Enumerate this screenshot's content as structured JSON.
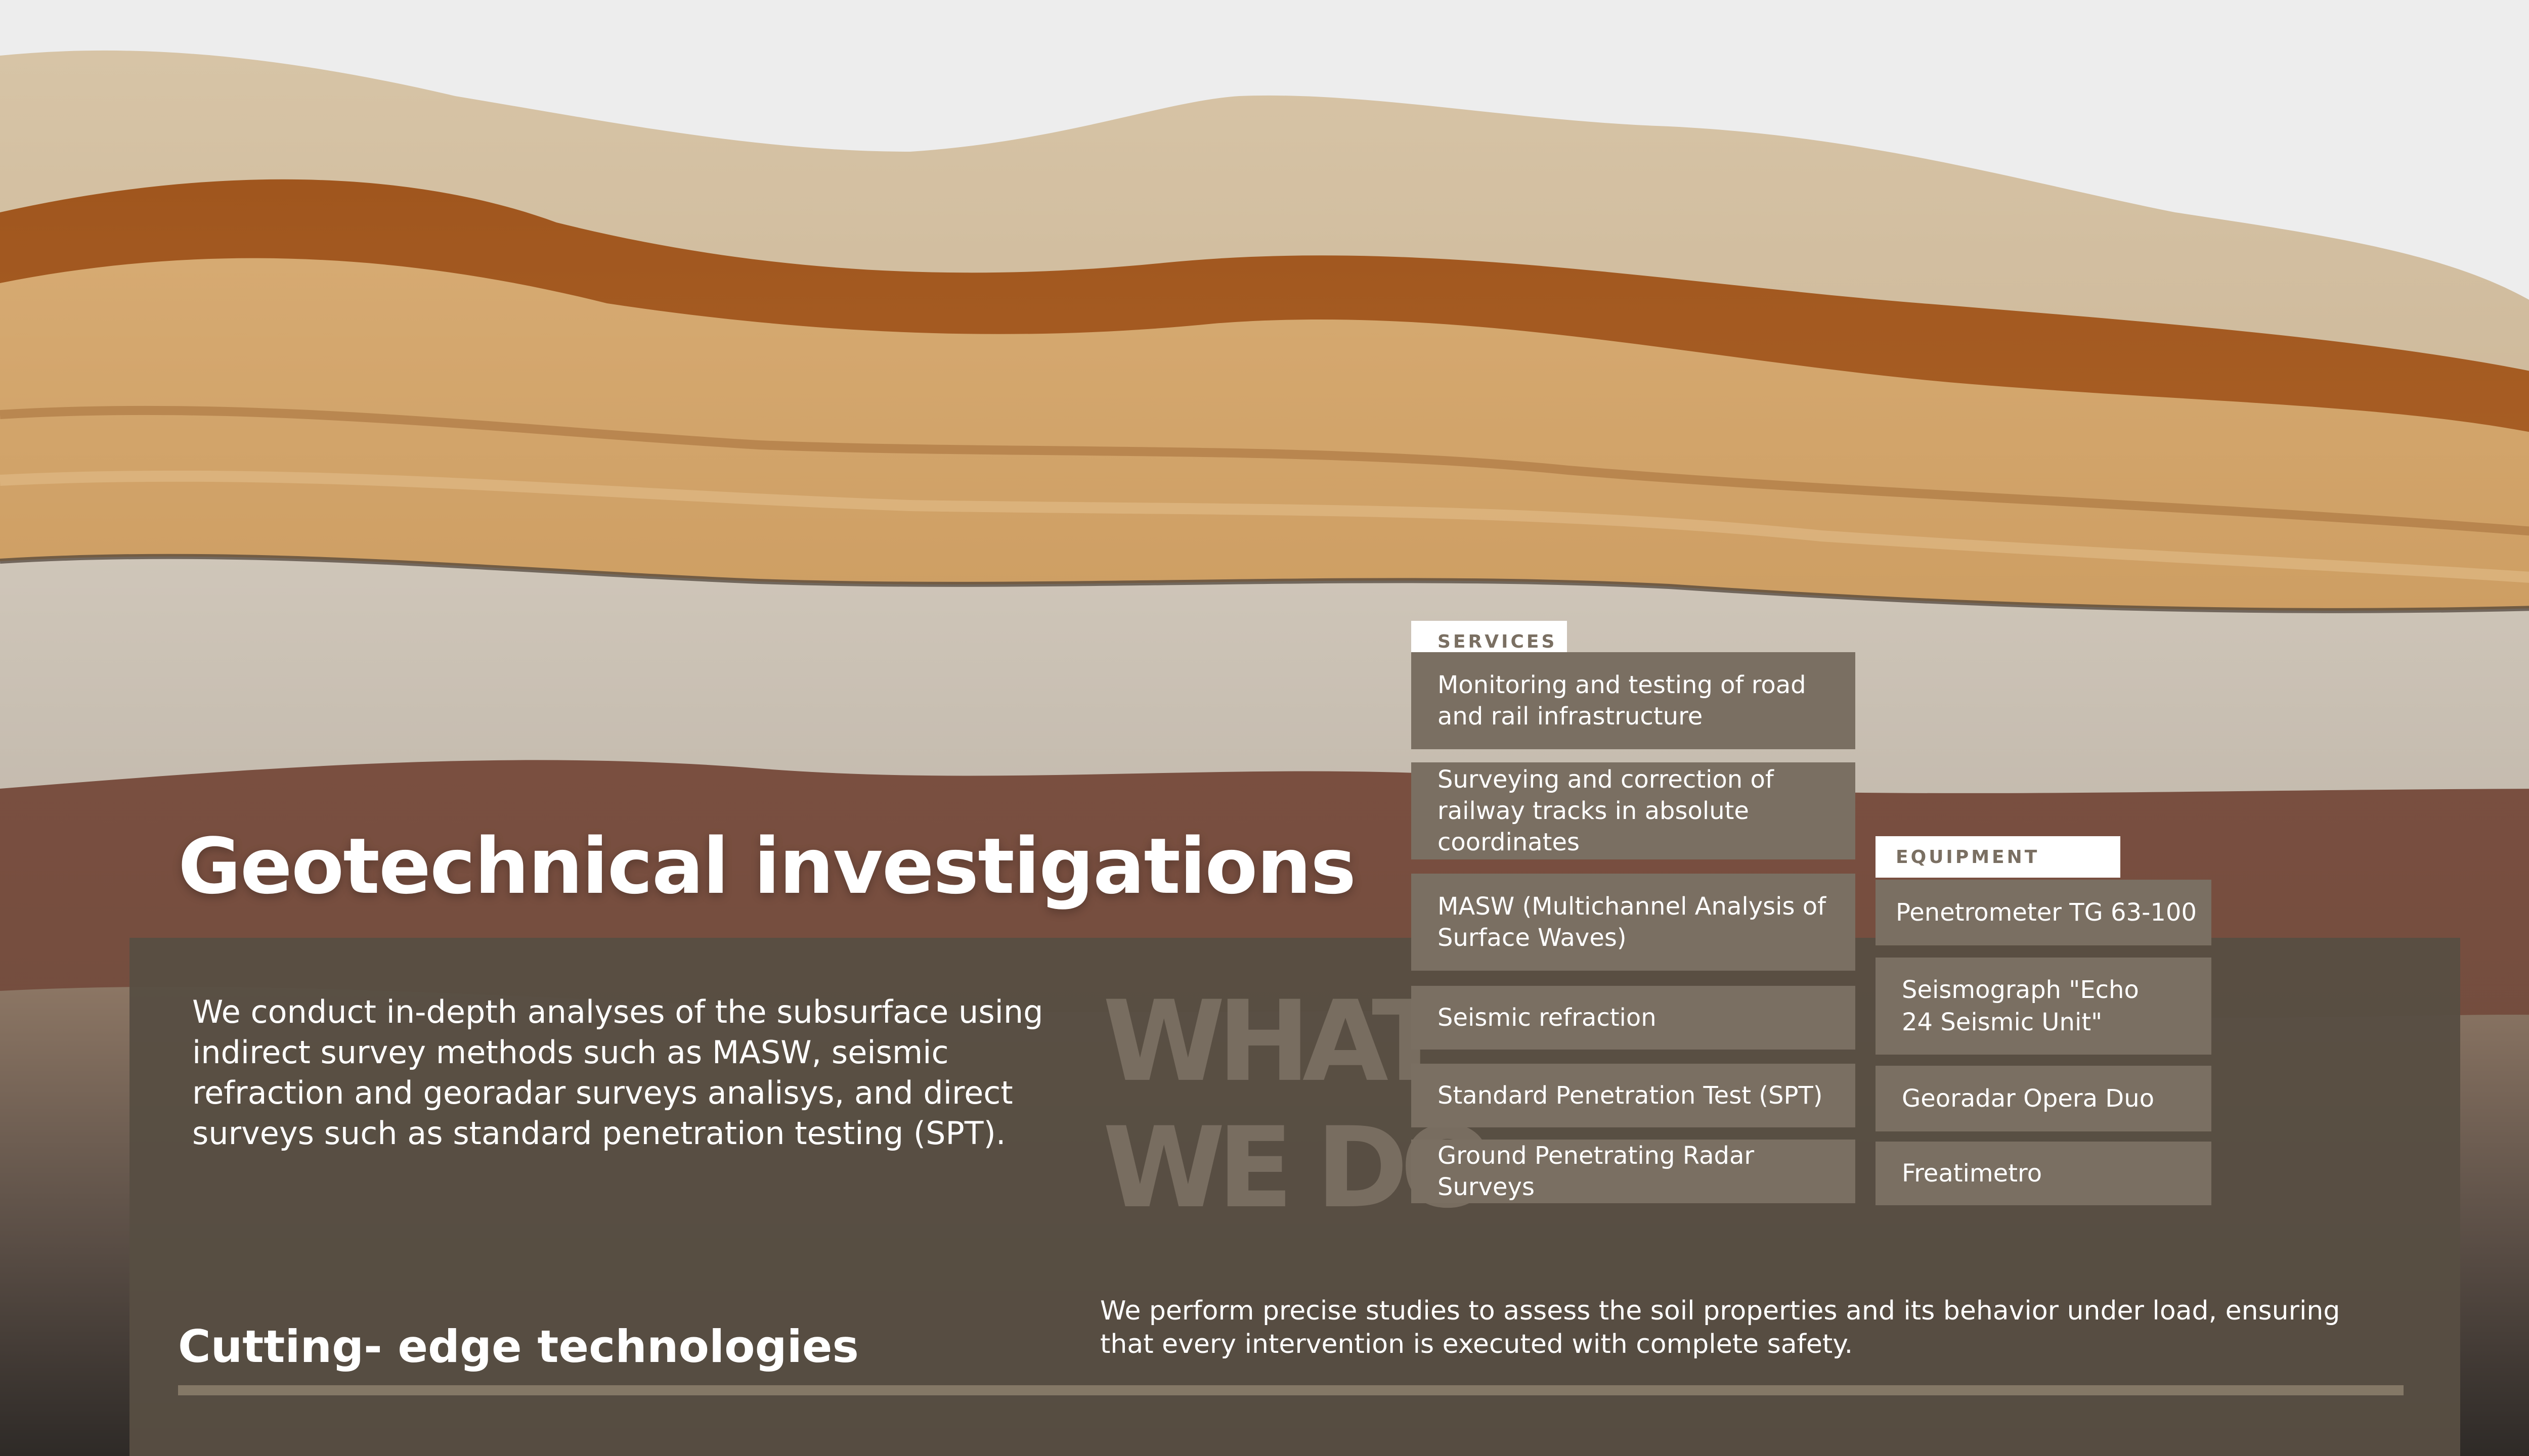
{
  "title": "Geotechnical investigations",
  "intro": "We conduct in-depth analyses of the subsurface using indirect survey methods such as MASW, seismic refraction and georadar surveys analisys, and  direct surveys such as standard penetration testing (SPT).",
  "watermark": {
    "line1": "WHAT",
    "line2": "WE DO"
  },
  "services": {
    "label": "SERVICES",
    "items": [
      "Monitoring and testing of road and rail infrastructure",
      "Surveying and correction of railway tracks in absolute coordinates",
      "MASW (Multichannel Analysis of Surface Waves)",
      "Seismic refraction",
      "Standard Penetration Test (SPT)",
      "Ground Penetrating Radar Surveys"
    ]
  },
  "equipment": {
    "label": "EQUIPMENT",
    "items": [
      "Penetrometer TG 63-100",
      "Seismograph  \"Echo 24 Seismic Unit\"",
      "Georadar Opera Duo",
      "Freatimetro"
    ]
  },
  "subtitle": "Cutting- edge technologies",
  "note": "We perform precise studies to assess the soil properties and its behavior under load,  ensuring that every intervention is executed with complete safety.",
  "colors": {
    "panel": "#574e43",
    "box": "#7a6f62",
    "rule": "#847866",
    "text": "#ffffff"
  }
}
